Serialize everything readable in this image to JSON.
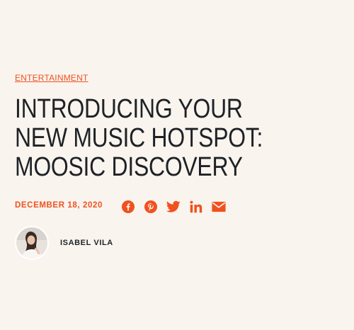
{
  "article": {
    "category": "ENTERTAINMENT",
    "title": "INTRODUCING YOUR NEW MUSIC HOTSPOT: MOOSIC DISCOVERY",
    "date": "DECEMBER 18, 2020",
    "author": "ISABEL VILA"
  },
  "share": {
    "icons": [
      "facebook-icon",
      "pinterest-icon",
      "twitter-icon",
      "linkedin-icon",
      "email-icon"
    ]
  },
  "colors": {
    "accent": "#f0511e",
    "background": "#f9f4ee",
    "text": "#1e2226"
  }
}
